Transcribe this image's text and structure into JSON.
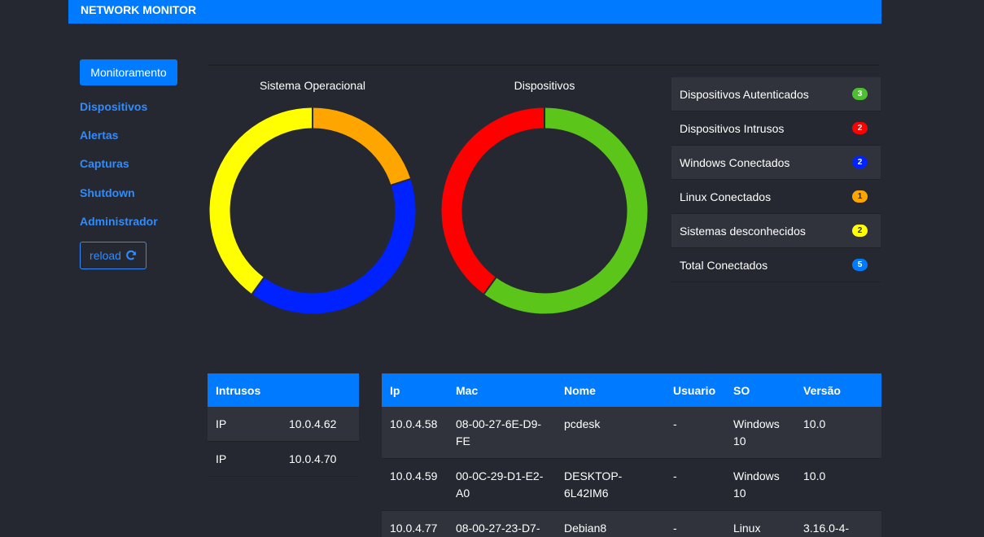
{
  "navbar": {
    "brand": "NETWORK MONITOR"
  },
  "sidebar": {
    "active": "Monitoramento",
    "links": [
      "Dispositivos",
      "Alertas",
      "Capturas",
      "Shutdown",
      "Administrador"
    ],
    "reload_label": "reload"
  },
  "charts": {
    "os_title": "Sistema Operacional",
    "devices_title": "Dispositivos"
  },
  "chart_data": [
    {
      "type": "pie",
      "title": "Sistema Operacional",
      "values": [
        1,
        2,
        2
      ],
      "colors": [
        "#ffa500",
        "#0022ff",
        "#ffff00"
      ]
    },
    {
      "type": "pie",
      "title": "Dispositivos",
      "values": [
        3,
        2
      ],
      "colors": [
        "#5cc51a",
        "#ff0000"
      ]
    }
  ],
  "summary": [
    {
      "label": "Dispositivos Autenticados",
      "count": "3",
      "color": "#4cc030",
      "text_color": "#ffffff"
    },
    {
      "label": "Dispositivos Intrusos",
      "count": "2",
      "color": "#ff0000",
      "text_color": "#ffffff"
    },
    {
      "label": "Windows Conectados",
      "count": "2",
      "color": "#0022ff",
      "text_color": "#ffffff"
    },
    {
      "label": "Linux Conectados",
      "count": "1",
      "color": "#ffa500",
      "text_color": "#252830"
    },
    {
      "label": "Sistemas desconhecidos",
      "count": "2",
      "color": "#ffff00",
      "text_color": "#252830"
    },
    {
      "label": "Total Conectados",
      "count": "5",
      "color": "#007bff",
      "text_color": "#ffffff"
    }
  ],
  "intrusos": {
    "header": "Intrusos",
    "rows": [
      {
        "label": "IP",
        "value": "10.0.4.62"
      },
      {
        "label": "IP",
        "value": "10.0.4.70"
      }
    ]
  },
  "devices": {
    "headers": [
      "Ip",
      "Mac",
      "Nome",
      "Usuario",
      "SO",
      "Versão"
    ],
    "rows": [
      [
        "10.0.4.58",
        "08-00-27-6E-D9-\nFE",
        "pcdesk",
        "-",
        "Windows\n10",
        "10.0"
      ],
      [
        "10.0.4.59",
        "00-0C-29-D1-E2-\nA0",
        "DESKTOP-\n6L42IM6",
        "-",
        "Windows\n10",
        "10.0"
      ],
      [
        "10.0.4.77",
        "08-00-27-23-D7-",
        "Debian8",
        "-",
        "Linux",
        "3.16.0-4-"
      ]
    ]
  }
}
